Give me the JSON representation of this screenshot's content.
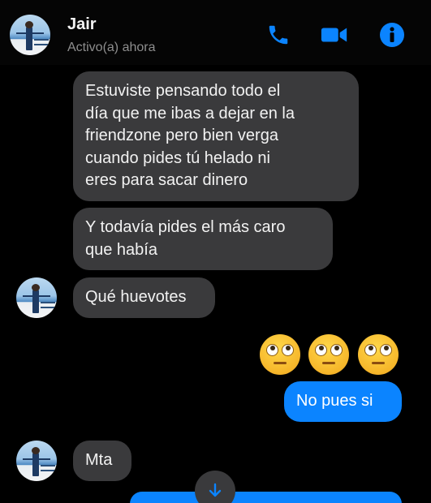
{
  "header": {
    "contact_name": "Jair",
    "status": "Activo(a) ahora",
    "accent_color": "#0b84ff",
    "icons": [
      "phone-icon",
      "video-camera-icon",
      "info-icon"
    ]
  },
  "messages": [
    {
      "direction": "received",
      "lines": [
        "Estuviste pensando todo el",
        "día que me ibas a dejar en la",
        "friendzone pero bien verga",
        "cuando pides tú helado ni",
        "eres para sacar dinero"
      ]
    },
    {
      "direction": "received",
      "lines": [
        "Y todavía pides el más caro",
        "que había"
      ]
    },
    {
      "direction": "received",
      "lines": [
        "Qué huevotes"
      ]
    },
    {
      "direction": "sent",
      "emoji": [
        "face-with-rolling-eyes",
        "face-with-rolling-eyes",
        "face-with-rolling-eyes"
      ]
    },
    {
      "direction": "sent",
      "lines": [
        "No pues si"
      ]
    },
    {
      "direction": "received",
      "lines": [
        "Mta"
      ]
    }
  ],
  "controls": {
    "scroll_icon": "arrow-down-icon"
  }
}
